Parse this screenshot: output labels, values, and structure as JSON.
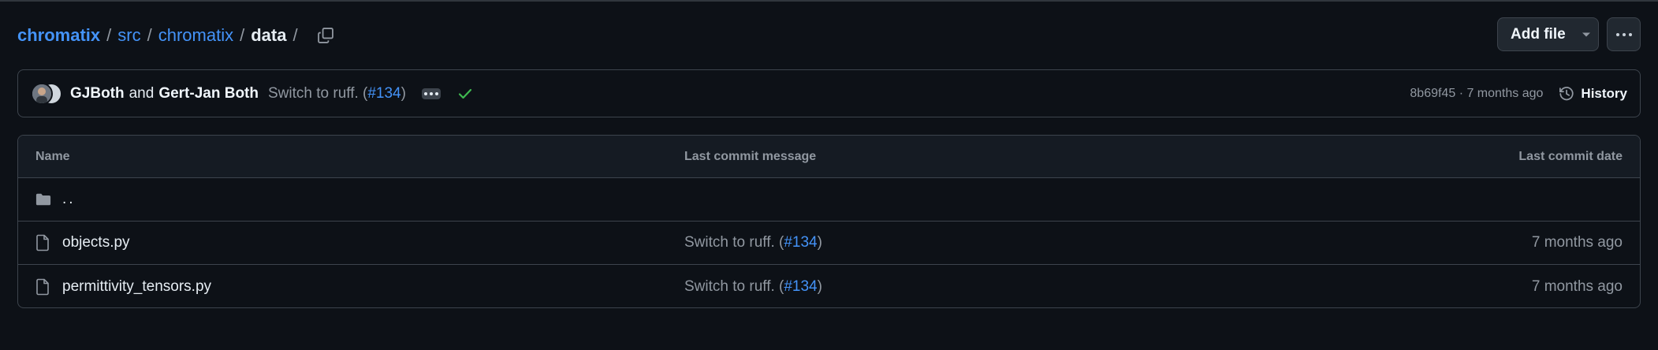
{
  "breadcrumb": {
    "repo": "chromatix",
    "parts": [
      "src",
      "chromatix"
    ],
    "current": "data",
    "separator": "/"
  },
  "toolbar": {
    "add_file_label": "Add file"
  },
  "commit": {
    "author1": "GJBoth",
    "and_text": "and",
    "author2": "Gert-Jan Both",
    "message_prefix": "Switch to ruff. (",
    "pr": "#134",
    "message_suffix": ")",
    "sha": "8b69f45",
    "time": "· 7 months ago",
    "history_label": "History",
    "status_color": "#3fb950"
  },
  "table": {
    "headers": {
      "name": "Name",
      "message": "Last commit message",
      "date": "Last commit date"
    },
    "parent_dir": "..",
    "rows": [
      {
        "name": "objects.py",
        "msg_prefix": "Switch to ruff. (",
        "pr": "#134",
        "msg_suffix": ")",
        "date": "7 months ago",
        "icon": "file-icon"
      },
      {
        "name": "permittivity_tensors.py",
        "msg_prefix": "Switch to ruff. (",
        "pr": "#134",
        "msg_suffix": ")",
        "date": "7 months ago",
        "icon": "file-icon"
      }
    ]
  },
  "colors": {
    "accent": "#4493f8",
    "background": "#0d1117",
    "border": "#3d444d"
  }
}
